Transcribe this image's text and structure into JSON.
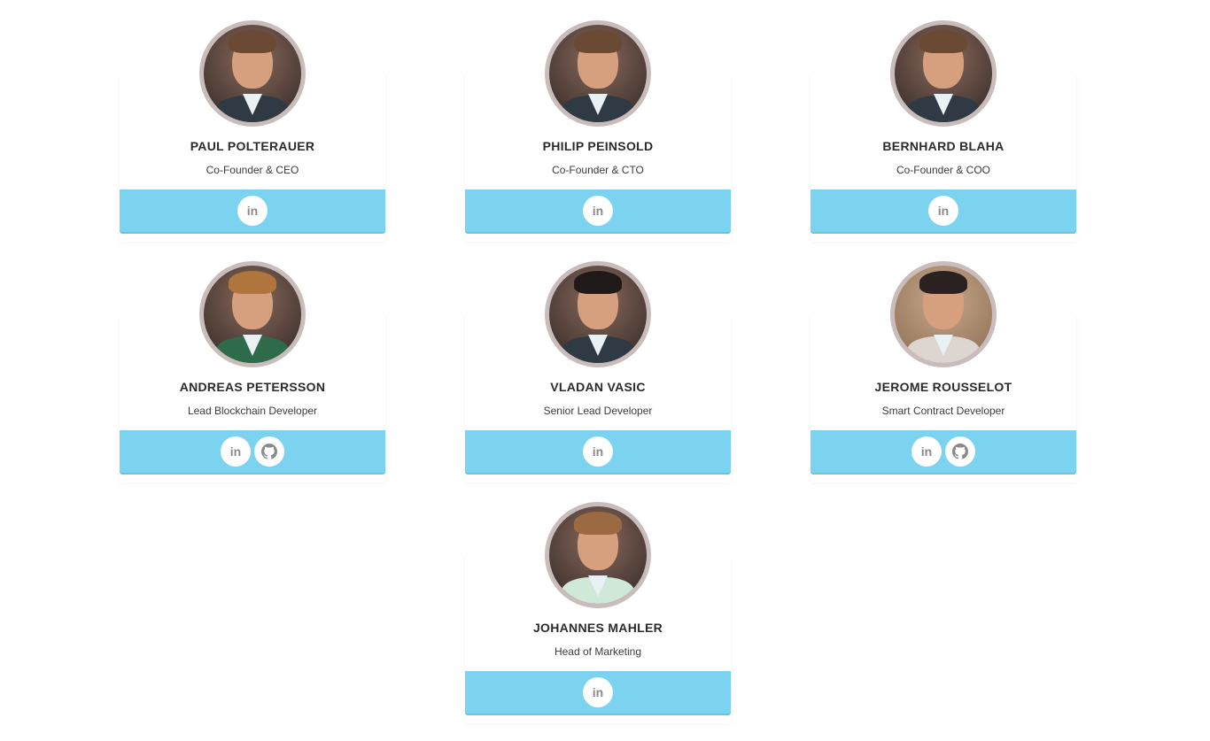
{
  "members": [
    {
      "name": "PAUL POLTERAUER",
      "role": "Co-Founder & CEO",
      "links": [
        "linkedin"
      ],
      "linkedin_glyph": "in"
    },
    {
      "name": "PHILIP PEINSOLD",
      "role": "Co-Founder & CTO",
      "links": [
        "linkedin"
      ],
      "linkedin_glyph": "in"
    },
    {
      "name": "BERNHARD BLAHA",
      "role": "Co-Founder & COO",
      "links": [
        "linkedin"
      ],
      "linkedin_glyph": "in"
    },
    {
      "name": "ANDREAS PETERSSON",
      "role": "Lead Blockchain Developer",
      "links": [
        "linkedin",
        "github"
      ],
      "linkedin_glyph": "in"
    },
    {
      "name": "VLADAN VASIC",
      "role": "Senior Lead Developer",
      "links": [
        "linkedin"
      ],
      "linkedin_glyph": "in"
    },
    {
      "name": "JEROME ROUSSELOT",
      "role": "Smart Contract Developer",
      "links": [
        "linkedin",
        "github"
      ],
      "linkedin_glyph": "in"
    },
    {
      "name": "JOHANNES MAHLER",
      "role": "Head of Marketing",
      "links": [
        "linkedin"
      ],
      "linkedin_glyph": "in"
    }
  ],
  "colors": {
    "social_bar": "#7bd3ef",
    "avatar_ring": "#c9bdbb",
    "text": "#2b2b2b"
  },
  "icons": {
    "linkedin": "linkedin-icon",
    "github": "github-icon"
  }
}
